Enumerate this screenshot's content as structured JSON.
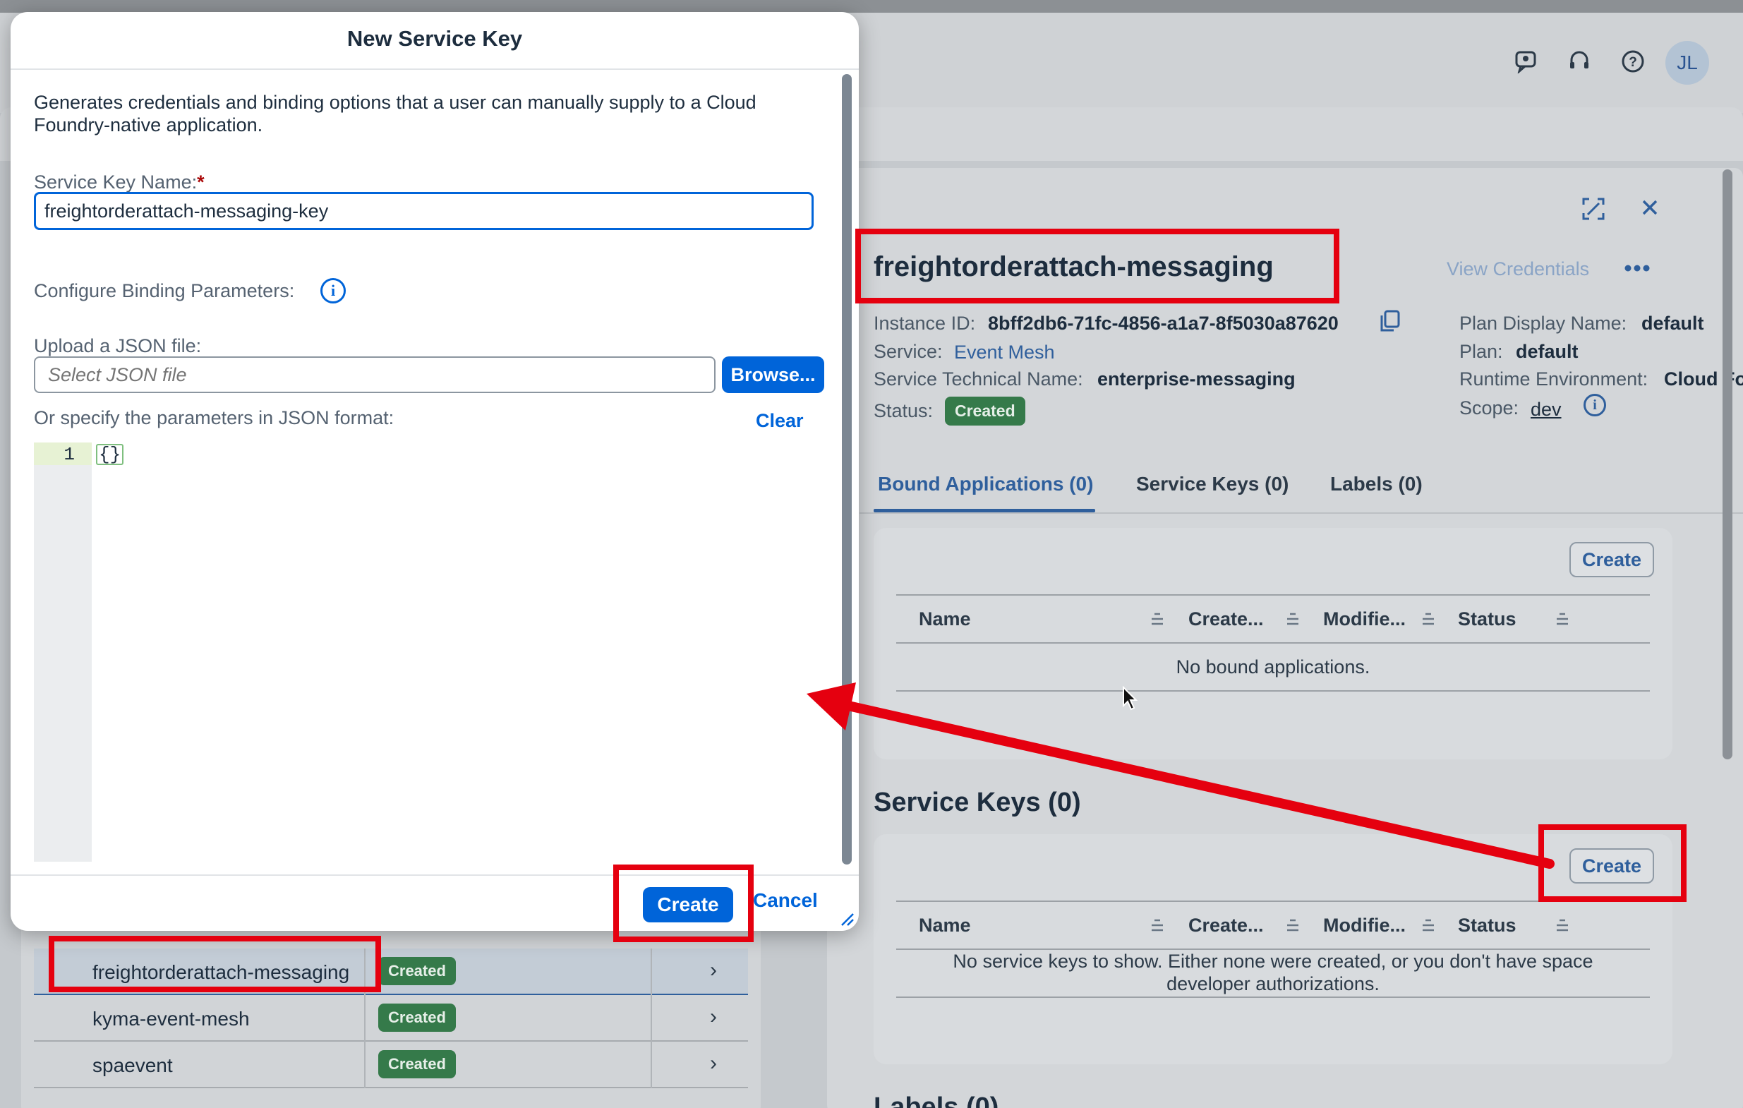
{
  "shell": {
    "avatar_initials": "JL",
    "icons": [
      "feedback-icon",
      "support-headset-icon",
      "help-icon"
    ]
  },
  "list": {
    "rows": [
      {
        "name": "freightorderattach-messaging",
        "status": "Created"
      },
      {
        "name": "kyma-event-mesh",
        "status": "Created"
      },
      {
        "name": "spaevent",
        "status": "Created"
      }
    ]
  },
  "detail": {
    "title": "freightorderattach-messaging",
    "view_credentials": "View Credentials",
    "instance_id_label": "Instance ID:",
    "instance_id": "8bff2db6-71fc-4856-a1a7-8f5030a87620",
    "service_label": "Service:",
    "service": "Event Mesh",
    "technical_name_label": "Service Technical Name:",
    "technical_name": "enterprise-messaging",
    "status_label": "Status:",
    "status": "Created",
    "plan_display_name_label": "Plan Display Name:",
    "plan_display_name": "default",
    "plan_label": "Plan:",
    "plan": "default",
    "runtime_label": "Runtime Environment:",
    "runtime": "Cloud Fo",
    "scope_label": "Scope:",
    "scope": "dev",
    "tabs": [
      "Bound Applications (0)",
      "Service Keys (0)",
      "Labels (0)"
    ],
    "bound_apps": {
      "create_label": "Create",
      "columns": [
        "Name",
        "Create...",
        "Modifie...",
        "Status"
      ],
      "empty": "No bound applications."
    },
    "service_keys": {
      "title": "Service Keys (0)",
      "create_label": "Create",
      "columns": [
        "Name",
        "Create...",
        "Modifie...",
        "Status"
      ],
      "empty": "No service keys to show. Either none were created, or you don't have space developer authorizations."
    },
    "labels_title": "Labels (0)"
  },
  "dialog": {
    "title": "New Service Key",
    "description": "Generates credentials and binding options that a user can manually supply to a Cloud Foundry-native application.",
    "key_name_label": "Service Key Name:",
    "key_name_required": "*",
    "key_name_value": "freightorderattach-messaging-key",
    "binding_label": "Configure Binding Parameters:",
    "upload_label": "Upload a JSON file:",
    "file_placeholder": "Select JSON file",
    "browse_label": "Browse...",
    "json_label": "Or specify the parameters in JSON format:",
    "clear_label": "Clear",
    "editor_line": "1",
    "editor_code": "{}",
    "create_label": "Create",
    "cancel_label": "Cancel"
  },
  "colors": {
    "accent": "#0064d9",
    "status_green": "#357a4a",
    "annotation_red": "#e5000f"
  }
}
